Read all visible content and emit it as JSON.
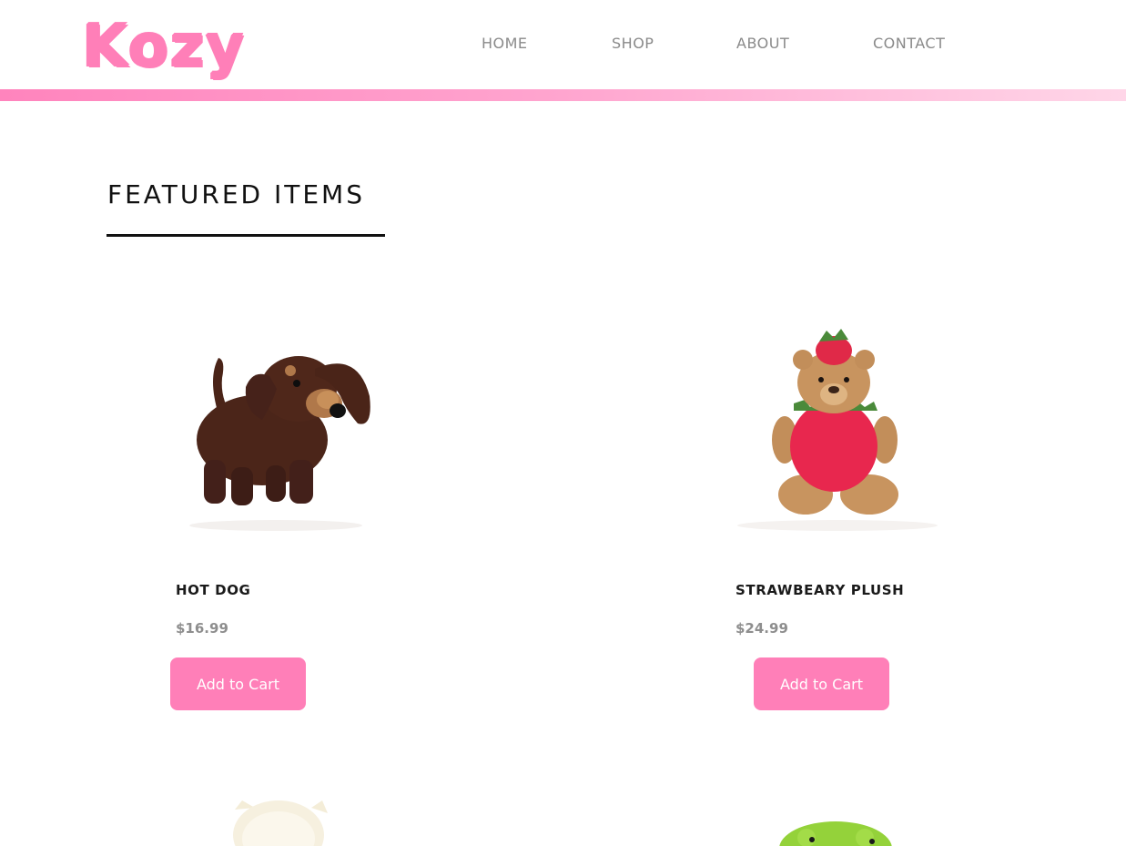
{
  "site": {
    "logo": "Kozy"
  },
  "nav": {
    "items": [
      "HOME",
      "SHOP",
      "ABOUT",
      "CONTACT"
    ]
  },
  "featured": {
    "title": "FEATURED ITEMS",
    "products": [
      {
        "name": "HOT DOG",
        "price": "$16.99",
        "button": "Add to Cart",
        "image": "dachshund-plush"
      },
      {
        "name": "STRAWBEARY PLUSH",
        "price": "$24.99",
        "button": "Add to Cart",
        "image": "strawberry-bear-plush"
      },
      {
        "image": "cream-cat-plush"
      },
      {
        "image": "green-frog-plush"
      }
    ]
  },
  "colors": {
    "accent": "#ff7fb8",
    "nav_text": "#8a8a8a",
    "price_text": "#8e8e8e",
    "heading": "#111111"
  }
}
